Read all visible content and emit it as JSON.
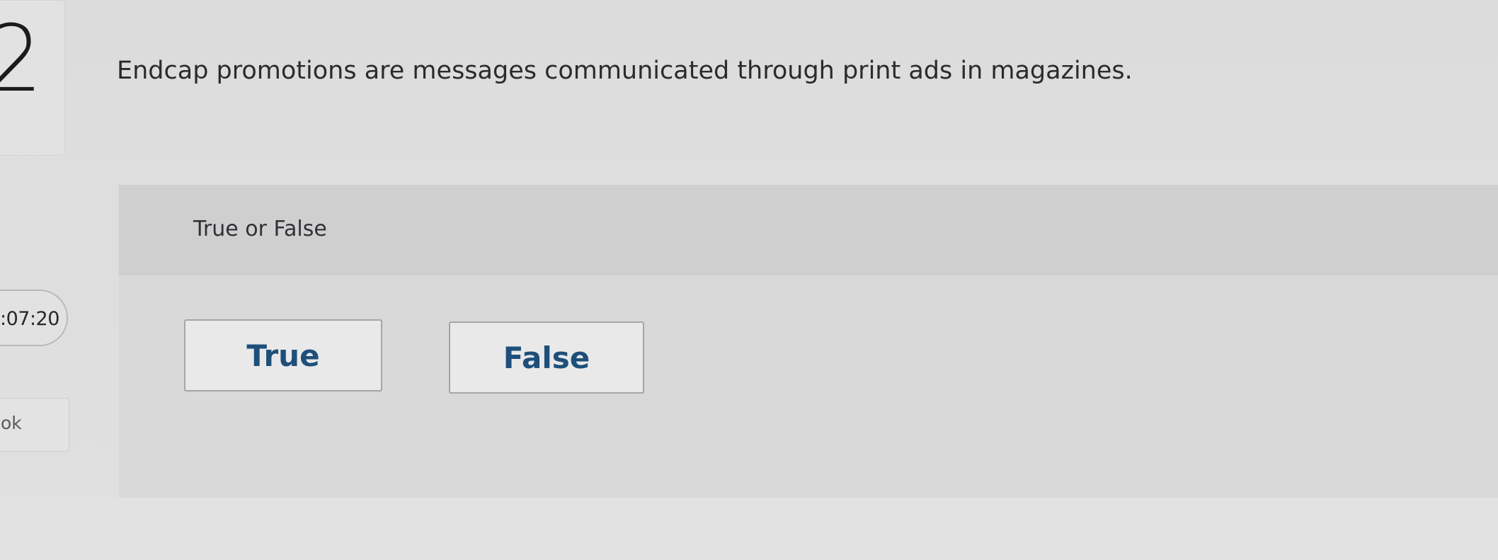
{
  "question": {
    "number": "2",
    "text": "Endcap promotions are messages communicated through print ads in magazines."
  },
  "answer": {
    "type_label": "True or False",
    "choices": [
      {
        "label": "True"
      },
      {
        "label": "False"
      }
    ]
  },
  "sidebar": {
    "timer": ":07:20",
    "book_label": "ok"
  },
  "colors": {
    "choice_text": "#1e4f7a",
    "panel_bg": "#d9d9da",
    "panel_header_bg": "#cfcfd0"
  }
}
